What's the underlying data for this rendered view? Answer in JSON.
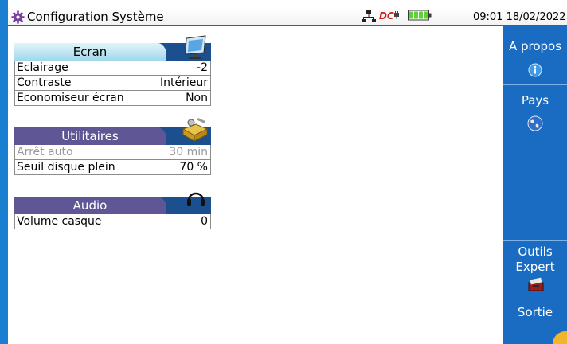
{
  "titlebar": {
    "title": "Configuration Système",
    "clock": "09:01 18/02/2022",
    "dc_label": "DC",
    "icons": [
      "gear-icon",
      "network-icon",
      "dc-power-icon",
      "battery-icon"
    ]
  },
  "sections": {
    "ecran": {
      "label": "Ecran",
      "icon": "monitor-icon",
      "rows": [
        {
          "key": "Eclairage",
          "value": "-2"
        },
        {
          "key": "Contraste",
          "value": "Intérieur"
        },
        {
          "key": "Economiseur écran",
          "value": "Non"
        }
      ]
    },
    "utilitaires": {
      "label": "Utilitaires",
      "icon": "toolbox-icon",
      "rows": [
        {
          "key": "Arrêt auto",
          "value": "30 min",
          "disabled": true
        },
        {
          "key": "Seuil disque plein",
          "value": "70 %"
        }
      ]
    },
    "audio": {
      "label": "Audio",
      "icon": "headphones-icon",
      "rows": [
        {
          "key": "Volume casque",
          "value": "0"
        }
      ]
    }
  },
  "softkeys": {
    "apropos": {
      "label": "A propos",
      "icon": "info-icon"
    },
    "pays": {
      "label": "Pays",
      "icon": "globe-icon"
    },
    "outils_line1": "Outils",
    "outils_line2": "Expert",
    "outils_icon": "expert-tools-icon",
    "sortie": {
      "label": "Sortie",
      "icon": "exit-icon"
    }
  },
  "colors": {
    "frame_blue": "#1a7fd0",
    "softkey_blue": "#1a6cc2",
    "section_purple": "#5f5795",
    "section_dark": "#1b4f8d",
    "ecran_header": "#9fd8ec",
    "disabled_text": "#9a9a9a"
  }
}
